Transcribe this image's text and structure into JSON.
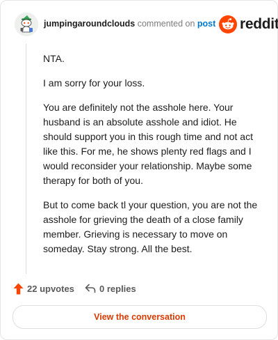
{
  "header": {
    "username": "jumpingaroundclouds",
    "commented_text": "commented on",
    "post_link": "post",
    "brand_wordmark": "reddit",
    "brand_color": "#ff4500"
  },
  "avatar": {
    "icon": "snoo-avatar-icon"
  },
  "comment": {
    "paragraphs": [
      "NTA.",
      "I am sorry for your loss.",
      "You are definitely not the asshole here. Your husband is an absolute asshole and idiot. He should support you in this rough time and not act like this. For me, he shows plenty red flags and I would reconsider your relationship. Maybe some therapy for both of you.",
      "But to come back tl your question, you are not the asshole for grieving the death of a close family member. Grieving is necessary to move on someday. Stay strong. All the best."
    ]
  },
  "footer": {
    "upvotes_label": "22 upvotes",
    "upvote_icon": "upvote-arrow-icon",
    "upvote_color": "#ff4500",
    "replies_label": "0 replies",
    "reply_icon": "reply-arrow-icon"
  },
  "cta": {
    "label": "View the conversation",
    "color": "#d93a00"
  }
}
